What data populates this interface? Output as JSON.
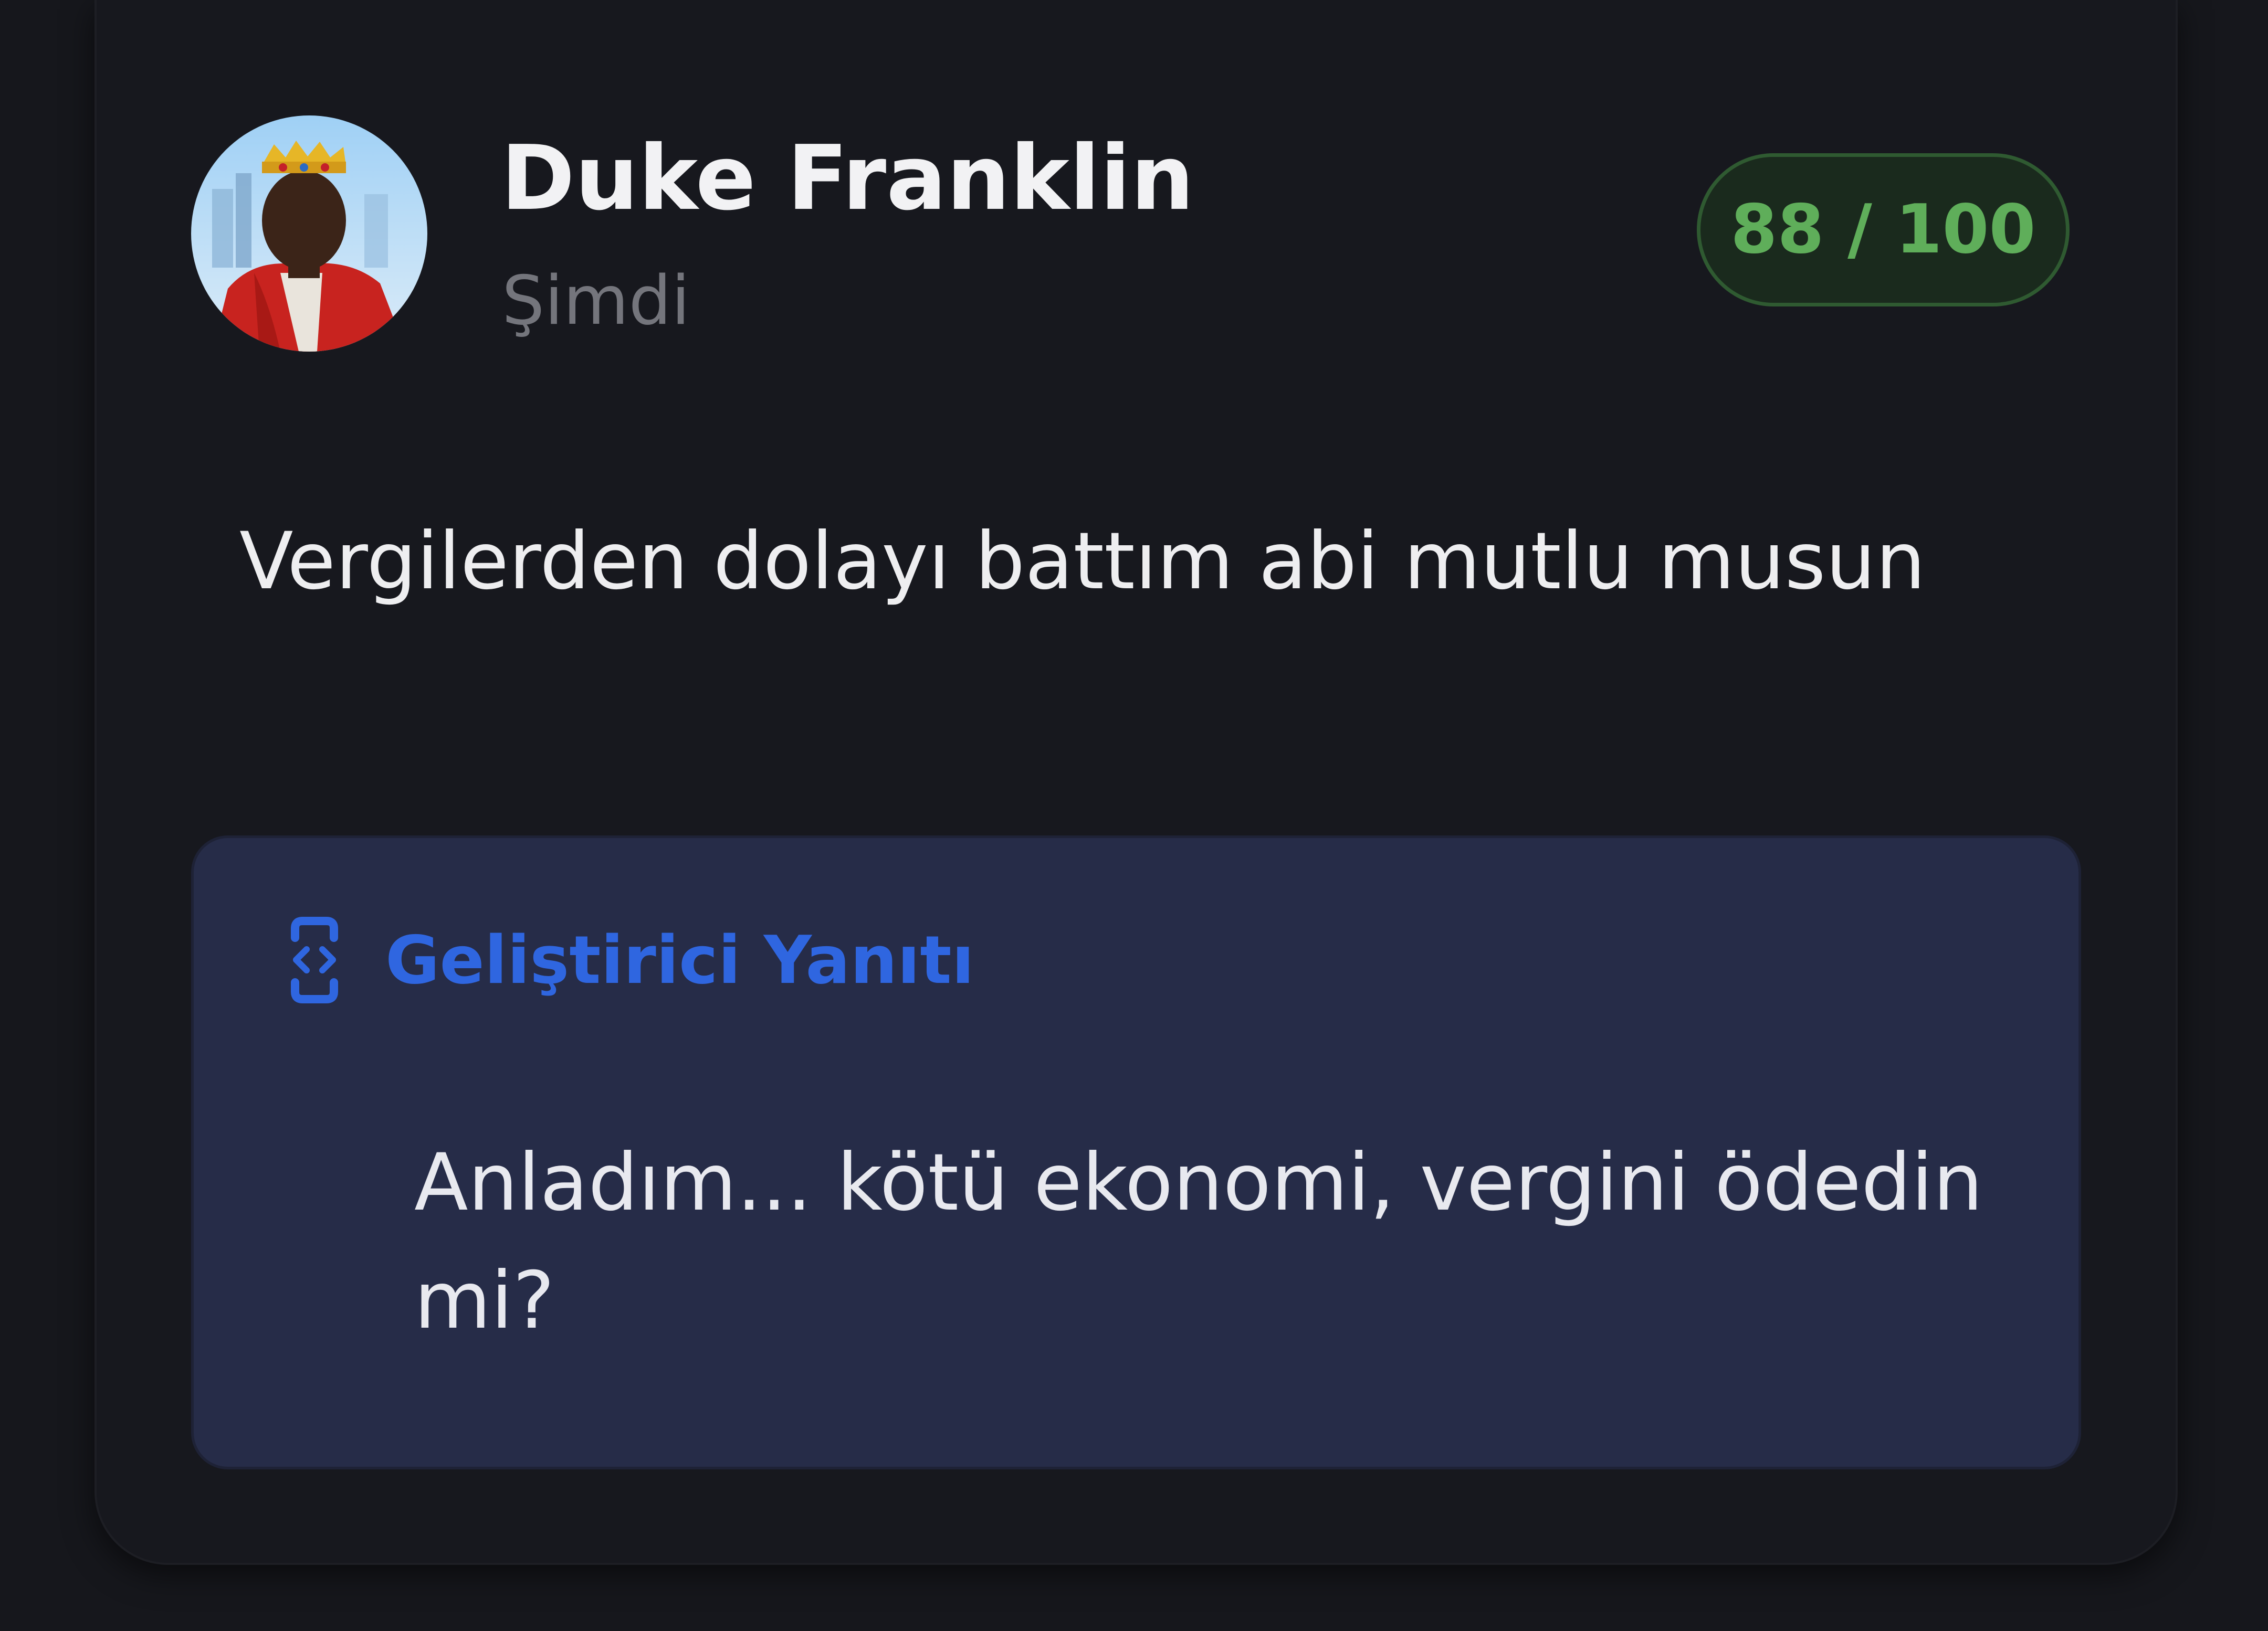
{
  "review": {
    "user_name": "Duke Franklin",
    "timestamp": "Şimdi",
    "score": "88 / 100",
    "text": "Vergilerden dolayı battım abi mutlu musun",
    "avatar_icon": "avatar-king-character"
  },
  "developer_reply": {
    "icon": "code-icon",
    "title": "Geliştirici Yanıtı",
    "text": "Anladım... kötü ekonomi, vergini ödedin mi?"
  },
  "colors": {
    "background": "#16171c",
    "card": "#17181e",
    "score_text": "#5fae5a",
    "score_border": "#2f5a31",
    "reply_bg": "#262c48",
    "reply_accent": "#2f66e0"
  }
}
